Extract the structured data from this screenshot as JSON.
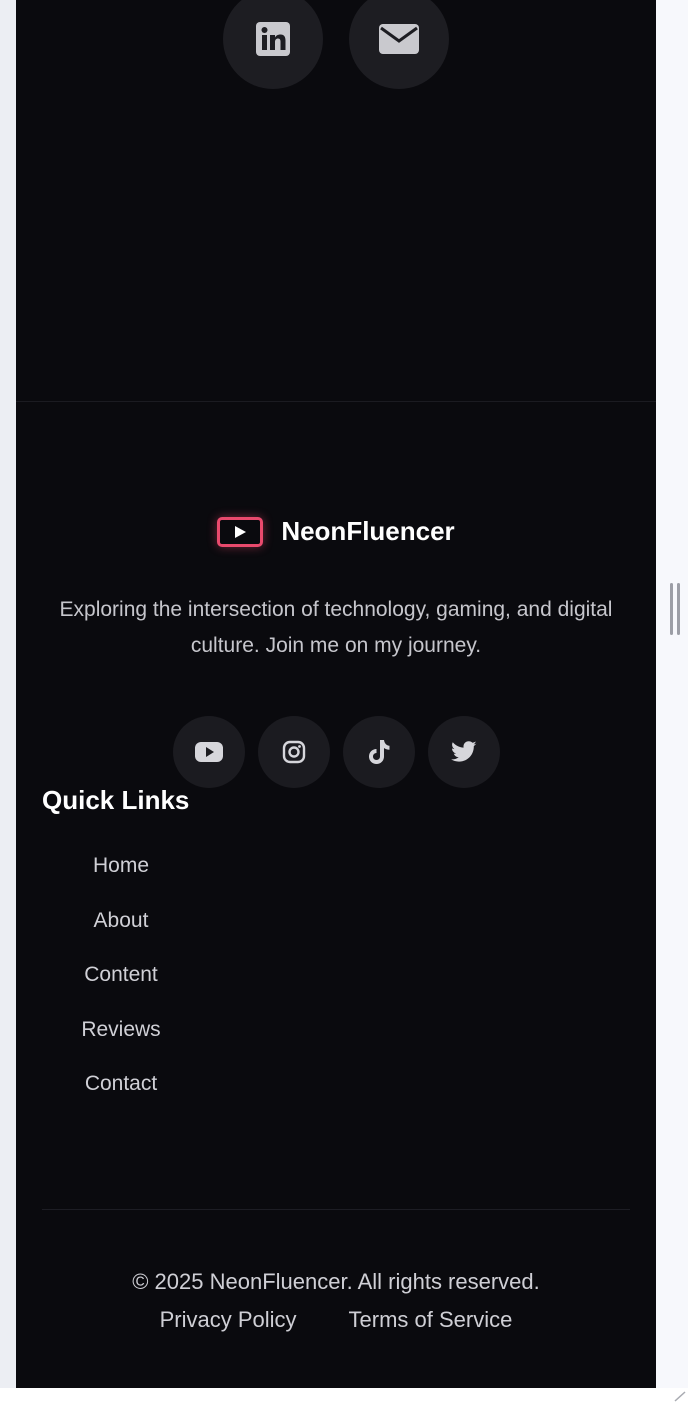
{
  "brand": {
    "name": "NeonFluencer",
    "accent_color": "#e94a6d",
    "logo_icon": "play-icon"
  },
  "tagline": "Exploring the intersection of technology, gaming, and digital culture. Join me on my journey.",
  "top_socials": [
    {
      "icon": "linkedin-icon"
    },
    {
      "icon": "mail-icon"
    }
  ],
  "socials": [
    {
      "icon": "youtube-icon"
    },
    {
      "icon": "instagram-icon"
    },
    {
      "icon": "tiktok-icon"
    },
    {
      "icon": "twitter-icon"
    }
  ],
  "quick_links": {
    "title": "Quick Links",
    "items": [
      {
        "label": "Home"
      },
      {
        "label": "About"
      },
      {
        "label": "Content"
      },
      {
        "label": "Reviews"
      },
      {
        "label": "Contact"
      }
    ]
  },
  "footer": {
    "copyright": "© 2025 NeonFluencer. All rights reserved.",
    "privacy_label": "Privacy Policy",
    "terms_label": "Terms of Service"
  },
  "colors": {
    "background": "#0a0a0e",
    "circle_button": "#1d1d22",
    "text_muted": "#c6c6cc"
  }
}
